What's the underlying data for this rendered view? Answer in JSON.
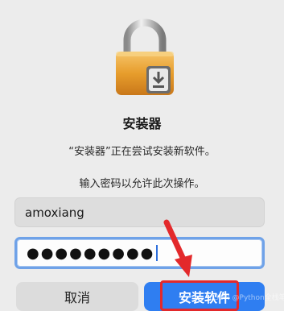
{
  "dialog": {
    "icon": "lock-icon",
    "title": "安装器",
    "message_line1": "“安装器”正在尝试安装新软件。",
    "message_line2": "输入密码以允许此次操作。",
    "username_value": "amoxiang",
    "password_masked": "●●●●●●●●●",
    "cancel_label": "取消",
    "install_label": "安装软件"
  },
  "colors": {
    "accent": "#2f7ef1",
    "highlight": "#e3292b"
  },
  "watermark": "CSDN @Python全栈笔记"
}
